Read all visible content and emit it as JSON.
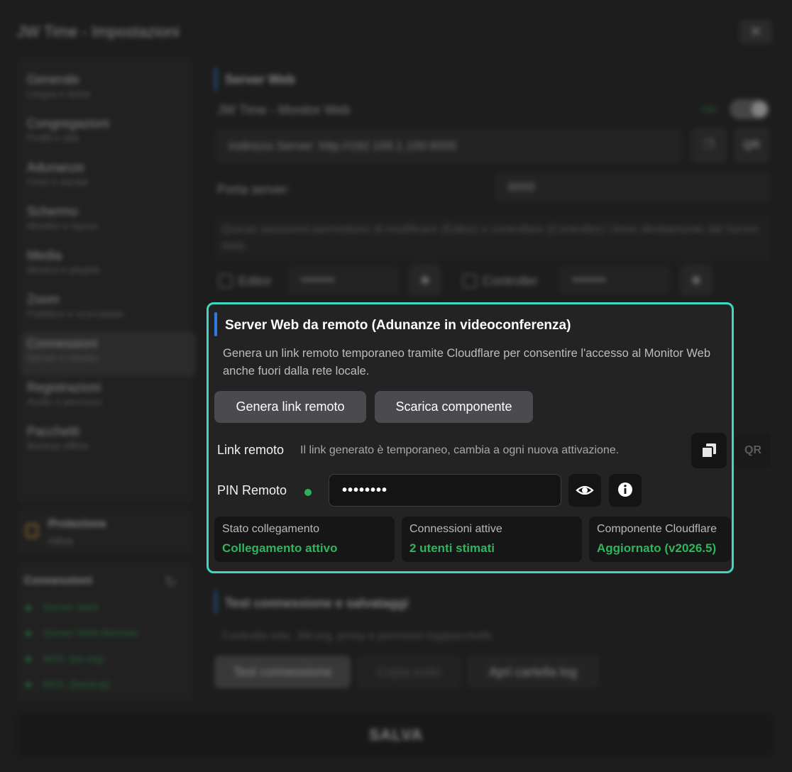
{
  "window": {
    "title": "JW Time - Impostazioni",
    "close_glyph": "✕"
  },
  "sidebar": {
    "items": [
      {
        "label": "Generale",
        "sub": "Lingua e tema"
      },
      {
        "label": "Congregazioni",
        "sub": "Profili e dati"
      },
      {
        "label": "Adunanze",
        "sub": "Orari e durate"
      },
      {
        "label": "Schermo",
        "sub": "Monitor e layout"
      },
      {
        "label": "Media",
        "sub": "Musica e playlist"
      },
      {
        "label": "Zoom",
        "sub": "Pubblico e scorciatoie"
      },
      {
        "label": "Connessioni",
        "sub": "Server e remoto"
      },
      {
        "label": "Registrazioni",
        "sub": "Audio e percorso"
      },
      {
        "label": "Pacchetti",
        "sub": "Backup offline"
      }
    ],
    "active_index": 6
  },
  "protection": {
    "title": "Protezione",
    "status": "Attiva"
  },
  "connections_panel": {
    "title": "Connessioni",
    "items": [
      "Server Web",
      "Server Web Remoto",
      "WOL (jw.org)",
      "WOL (backup)"
    ],
    "status_color": "#2fb05a"
  },
  "server_web": {
    "section_title": "Server Web",
    "monitor_label": "JW Time - Monitor Web",
    "toggle_text": "ON",
    "address": "Indirizzo Server: http://192.168.1.100:8000",
    "qr_label": "QR",
    "port_label": "Porta server:",
    "port_value": "8000",
    "password_note": "Queste password permettono di modificare (Editor) o controllare (Controller) i timer direttamente dal Server Web.",
    "editor_label": "Editor",
    "editor_value": "••••••••",
    "controller_label": "Controller",
    "controller_value": "••••••••"
  },
  "test_section": {
    "title": "Test connessione e salvataggi",
    "desc": "Controlla rete, JW.org, proxy e permessi log/pacchetti.",
    "buttons": [
      "Test connessione",
      "Copia esito",
      "Apri cartella log"
    ]
  },
  "save_label": "SALVA",
  "remote": {
    "title": "Server Web da remoto (Adunanze in videoconferenza)",
    "description": "Genera un link remoto temporaneo tramite Cloudflare per consentire l'accesso al Monitor Web anche fuori dalla rete locale.",
    "generate_label": "Genera link remoto",
    "download_label": "Scarica componente",
    "link_label": "Link remoto",
    "link_hint": "Il link generato è temporaneo, cambia a ogni nuova attivazione.",
    "pin_label": "PIN Remoto",
    "pin_value": "••••••••",
    "qr_label": "QR",
    "stats": [
      {
        "label": "Stato collegamento",
        "value": "Collegamento attivo"
      },
      {
        "label": "Connessioni attive",
        "value": "2 utenti stimati"
      },
      {
        "label": "Componente Cloudflare",
        "value": "Aggiornato (v2026.5)"
      }
    ]
  },
  "colors": {
    "accent_border": "#3ed8c1",
    "section_bar": "#2d7be0",
    "status_green": "#2fb55c"
  }
}
